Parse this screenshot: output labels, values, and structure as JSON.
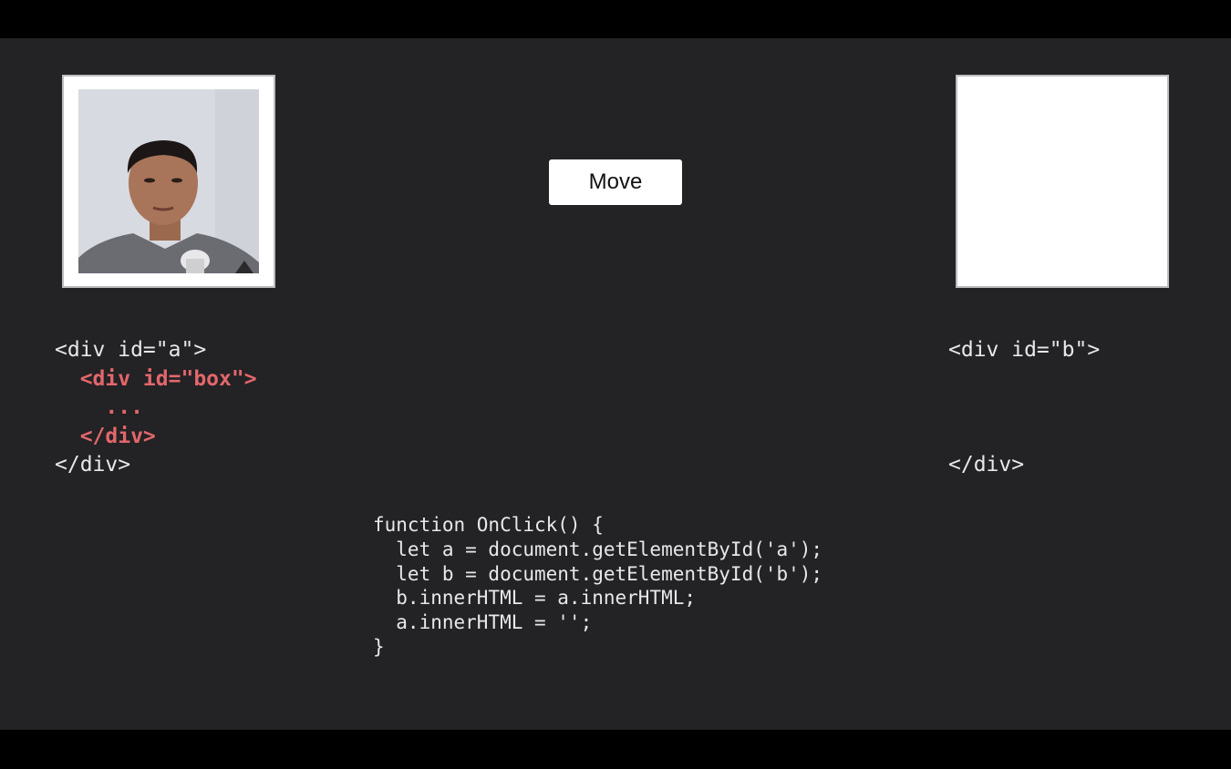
{
  "button": {
    "label": "Move"
  },
  "code_a": {
    "open": "<div id=\"a\">",
    "inner_open": "  <div id=\"box\">",
    "inner_body": "    ...",
    "inner_close": "  </div>",
    "close": "</div>"
  },
  "code_b": {
    "open": "<div id=\"b\">",
    "close": "</div>"
  },
  "function_code": [
    "function OnClick() {",
    "  let a = document.getElementById('a');",
    "  let b = document.getElementById('b');",
    "  b.innerHTML = a.innerHTML;",
    "  a.innerHTML = '';",
    "}"
  ],
  "colors": {
    "background": "#232225",
    "letterbox": "#000000",
    "highlight": "#e2676b",
    "code_text": "#e8e8e8"
  }
}
